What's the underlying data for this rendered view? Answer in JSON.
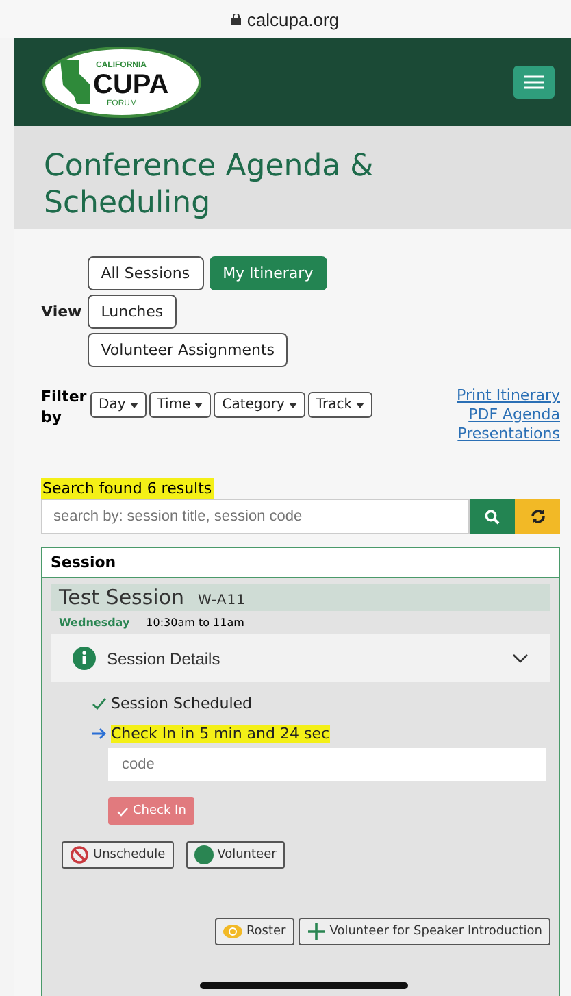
{
  "browser": {
    "url": "calcupa.org"
  },
  "header": {
    "logo": {
      "top": "CALIFORNIA",
      "main": "CUPA",
      "bottom": "FORUM"
    }
  },
  "page_title": "Conference Agenda & Scheduling",
  "view": {
    "label": "View",
    "options": [
      {
        "label": "All Sessions",
        "selected": false
      },
      {
        "label": "My Itinerary",
        "selected": true
      },
      {
        "label": "Lunches",
        "selected": false
      },
      {
        "label": "Volunteer Assignments",
        "selected": false
      }
    ]
  },
  "filter": {
    "label": "Filter by",
    "dropdowns": [
      "Day",
      "Time",
      "Category",
      "Track"
    ]
  },
  "links": [
    "Print Itinerary",
    "PDF Agenda",
    "Presentations"
  ],
  "search": {
    "result_text": "Search found 6 results",
    "placeholder": "search by: session title, session code"
  },
  "session_table": {
    "heading": "Session",
    "session": {
      "title": "Test Session",
      "code": "W-A11",
      "day": "Wednesday",
      "time": "10:30am to 11am",
      "details_label": "Session Details",
      "expanded": true,
      "status": "Session Scheduled",
      "checkin_notice": "Check In in 5 min and 24 sec",
      "code_placeholder": "code",
      "checkin_button": {
        "label": "Check In",
        "disabled": true
      },
      "actions": [
        "Unschedule",
        "Volunteer"
      ],
      "footer_actions": [
        "Roster",
        "Volunteer for Speaker Introduction"
      ]
    }
  }
}
